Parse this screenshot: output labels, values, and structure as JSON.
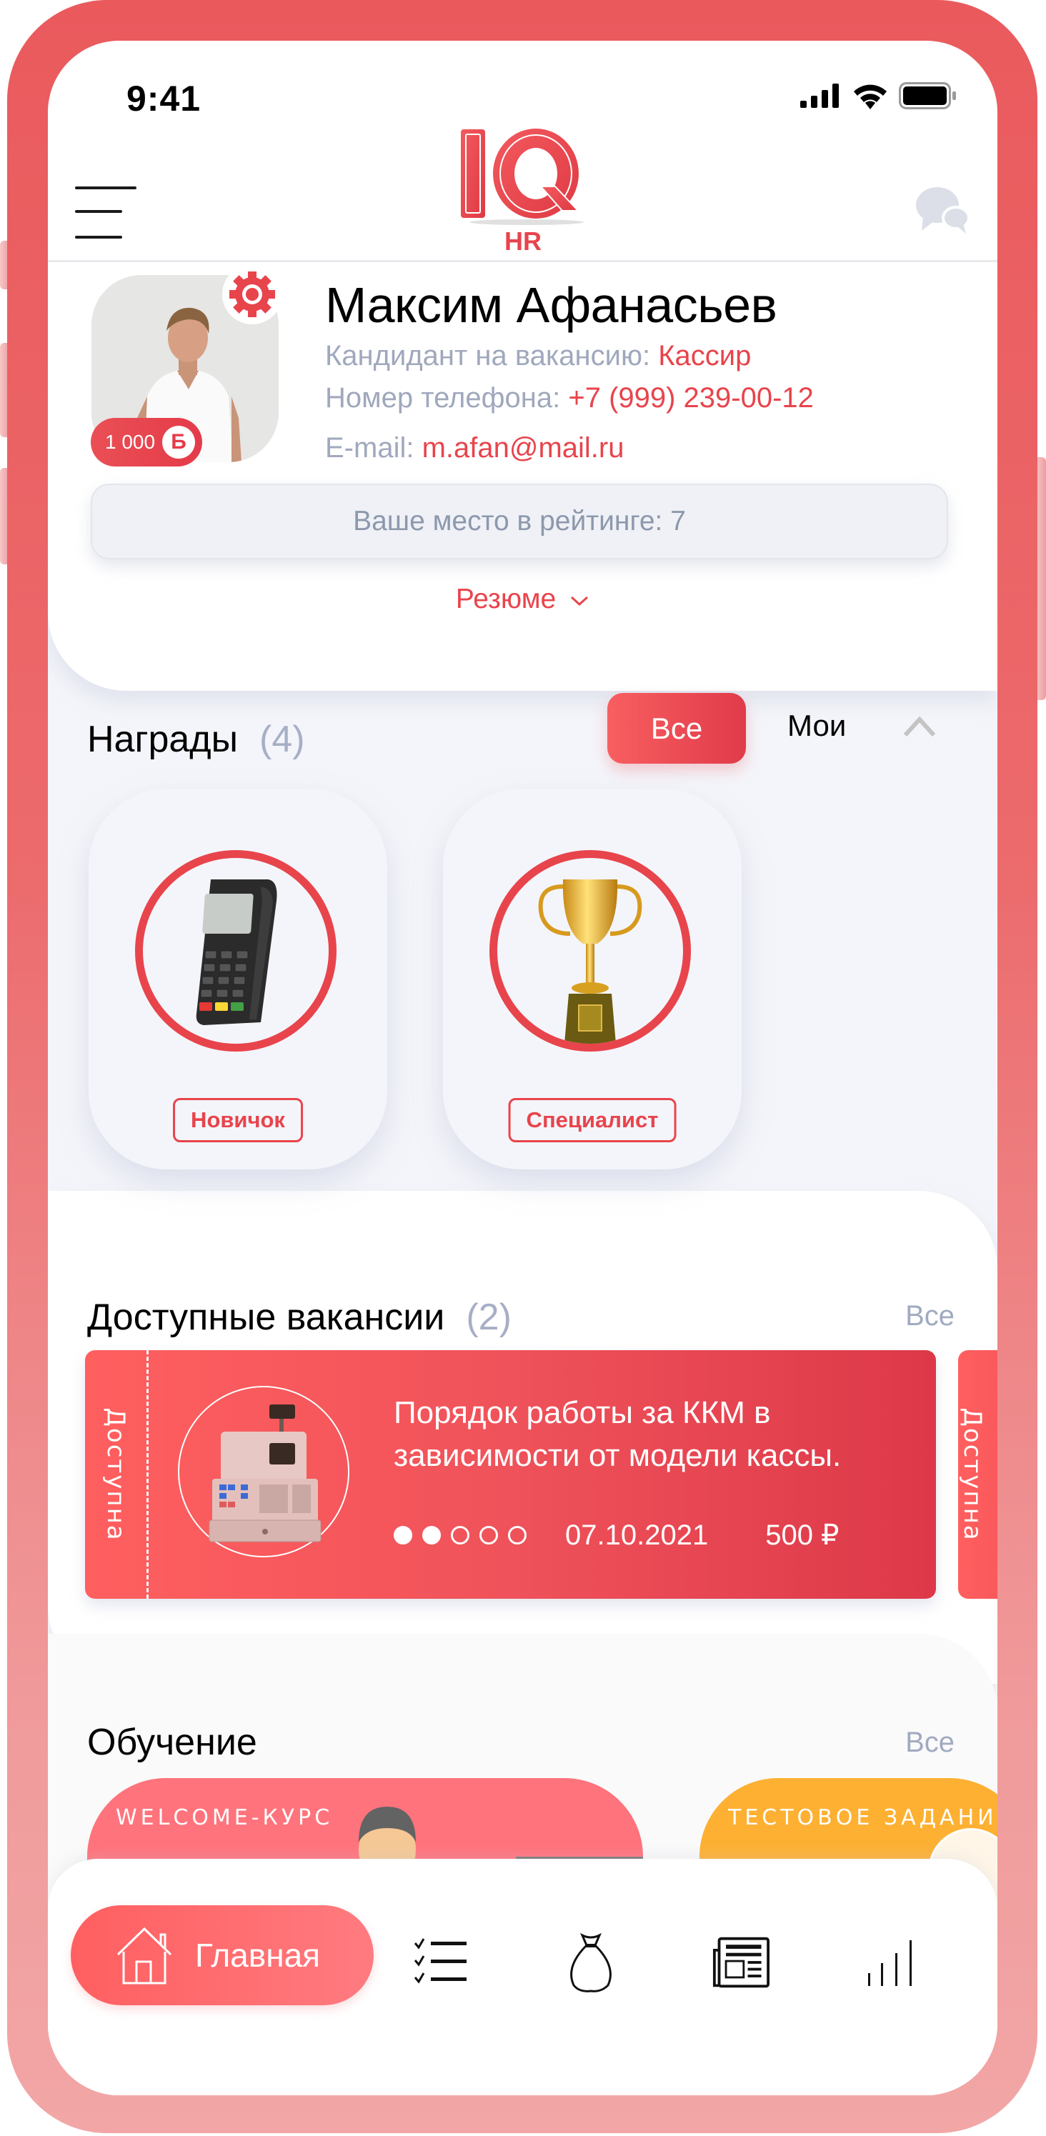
{
  "status_bar": {
    "time": "9:41",
    "icons": [
      "signal-icon",
      "wifi-icon",
      "battery-icon"
    ]
  },
  "header": {
    "logo_text": "IQ",
    "logo_subtitle": "HR",
    "menu_icon": "hamburger-menu-icon",
    "chat_icon": "chat-bubbles-icon"
  },
  "profile": {
    "name": "Максим Афанасьев",
    "vacancy_label": "Кандидант на вакансию:",
    "vacancy_value": "Кассир",
    "phone_label": "Номер телефона:",
    "phone_value": "+7 (999) 239-00-12",
    "email_label": "E-mail:",
    "email_value": "m.afan@mail.ru",
    "points": "1 000",
    "points_currency": "Б",
    "rating_text": "Ваше место в рейтинге: 7",
    "resume_label": "Резюме"
  },
  "awards": {
    "title": "Награды",
    "count": "(4)",
    "filter_all": "Все",
    "filter_mine": "Мои",
    "items": [
      {
        "label": "Новичок",
        "image": "payment-terminal-icon"
      },
      {
        "label": "Специалист",
        "image": "trophy-cup-icon"
      }
    ]
  },
  "vacancies": {
    "title": "Доступные вакансии",
    "count": "(2)",
    "see_all": "Все",
    "items": [
      {
        "status": "Доступна",
        "title": "Порядок работы за ККМ в зависимости от модели кассы.",
        "date": "07.10.2021",
        "price": "500 ₽",
        "progress_filled": 2,
        "progress_total": 5,
        "image": "cash-register-icon"
      },
      {
        "status": "Доступна"
      }
    ]
  },
  "training": {
    "title": "Обучение",
    "see_all": "Все",
    "courses": [
      {
        "label": "WELCOME-КУРС",
        "color": "#ff737c"
      },
      {
        "label": "ТЕСТОВОЕ ЗАДАНИЕ",
        "color": "#fdb032"
      }
    ]
  },
  "nav": {
    "home_label": "Главная",
    "items": [
      "home-icon",
      "checklist-icon",
      "money-bag-icon",
      "newspaper-icon",
      "rating-bars-icon"
    ]
  },
  "colors": {
    "accent": "#e8444c",
    "frame": "#ec6a6c",
    "muted": "#a0a8bd",
    "panel": "#f4f5fa"
  }
}
